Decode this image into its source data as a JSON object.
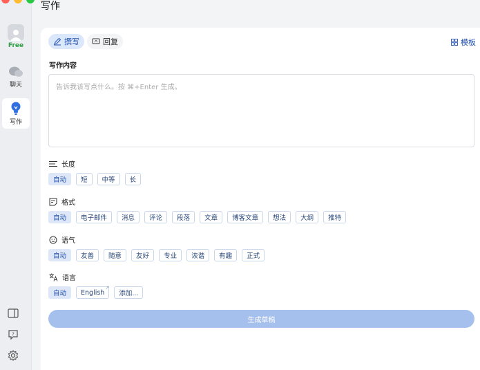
{
  "rail": {
    "free_badge": "Free",
    "chat_label": "聊天",
    "write_label": "写作"
  },
  "header": {
    "title": "写作"
  },
  "tabs": {
    "compose": "撰写",
    "reply": "回复"
  },
  "template_label": "模板",
  "content": {
    "label": "写作内容",
    "placeholder": "告诉我该写点什么。按 ⌘+Enter 生成。"
  },
  "length": {
    "title": "长度",
    "options": [
      "自动",
      "短",
      "中等",
      "长"
    ]
  },
  "format": {
    "title": "格式",
    "options": [
      "自动",
      "电子邮件",
      "消息",
      "评论",
      "段落",
      "文章",
      "博客文章",
      "想法",
      "大纲",
      "推特"
    ]
  },
  "tone": {
    "title": "语气",
    "options": [
      "自动",
      "友善",
      "随意",
      "友好",
      "专业",
      "诙谐",
      "有趣",
      "正式"
    ]
  },
  "language": {
    "title": "语言",
    "options": [
      "自动",
      "English",
      "添加..."
    ]
  },
  "generate_label": "生成草稿",
  "colors": {
    "accent": "#1f4fae",
    "accent_light": "#dbe7fb",
    "button": "#a6c0ee",
    "free": "#2ea043"
  }
}
